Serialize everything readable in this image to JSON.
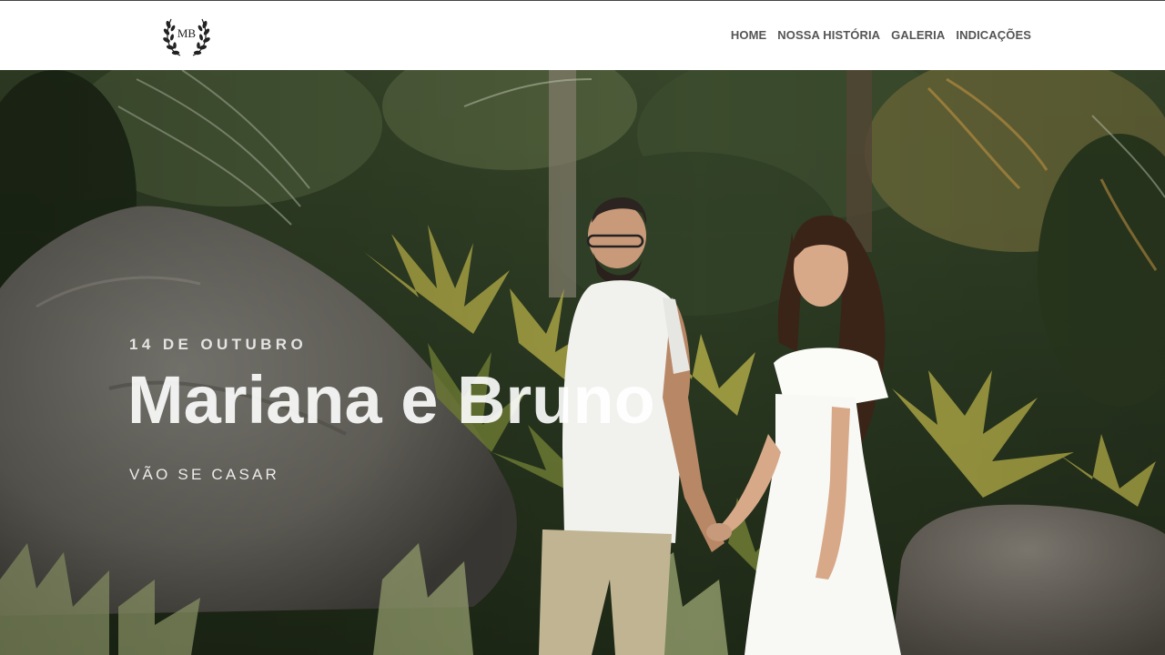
{
  "header": {
    "logo_icon": "monogram-laurel-wreath-icon",
    "logo_text": "MB",
    "nav": [
      {
        "label": "HOME"
      },
      {
        "label": "NOSSA HISTÓRIA"
      },
      {
        "label": "GALERIA"
      },
      {
        "label": "INDICAÇÕES"
      }
    ]
  },
  "hero": {
    "date": "14 DE OUTUBRO",
    "title": "Mariana e Bruno",
    "subtitle": "VÃO SE CASAR",
    "image": "couple-holding-hands-in-tropical-garden-photo"
  },
  "colors": {
    "nav_text": "#555555",
    "header_bg": "#ffffff",
    "hero_text": "#ffffff"
  }
}
